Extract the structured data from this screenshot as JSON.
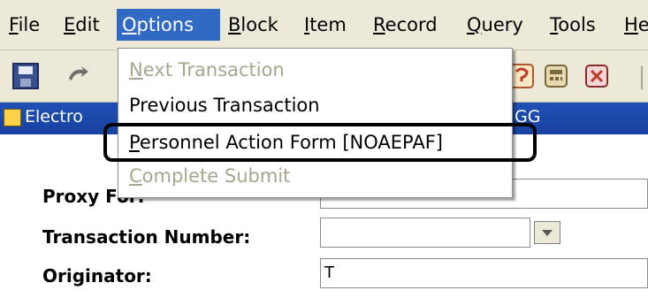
{
  "menubar": {
    "items": [
      {
        "first": "F",
        "rest": "ile"
      },
      {
        "first": "E",
        "rest": "dit"
      },
      {
        "first": "O",
        "rest": "ptions"
      },
      {
        "first": "B",
        "rest": "lock"
      },
      {
        "first": "I",
        "rest": "tem"
      },
      {
        "first": "R",
        "rest": "ecord"
      },
      {
        "first": "Q",
        "rest": "uery"
      },
      {
        "first": "T",
        "rest": "ools"
      },
      {
        "first": "H",
        "rest": "e"
      }
    ]
  },
  "toolbar": {
    "icons": [
      "save-icon",
      "rollback-icon",
      "help-icon",
      "calculator-icon",
      "exit-icon"
    ]
  },
  "window": {
    "title_visible": "Electro",
    "title_right": "GG"
  },
  "options_menu": {
    "items": [
      {
        "first": "N",
        "rest": "ext Transaction",
        "enabled": false
      },
      {
        "first": "",
        "rest": "Previous Transaction",
        "enabled": true
      },
      {
        "first": "P",
        "rest": "ersonnel Action Form [NOAEPAF]",
        "enabled": true
      },
      {
        "first": "C",
        "rest": "omplete Submit",
        "enabled": false
      }
    ]
  },
  "form": {
    "proxy_for_label": "Proxy For:",
    "transaction_number_label": "Transaction Number:",
    "transaction_number_value": "",
    "originator_label": "Originator:",
    "originator_value": "T"
  },
  "colors": {
    "menu_bg": "#ece9d8",
    "menu_highlight": "#316ac5",
    "titlebar": "#1f51b5",
    "disabled_text": "#a8a48e"
  }
}
